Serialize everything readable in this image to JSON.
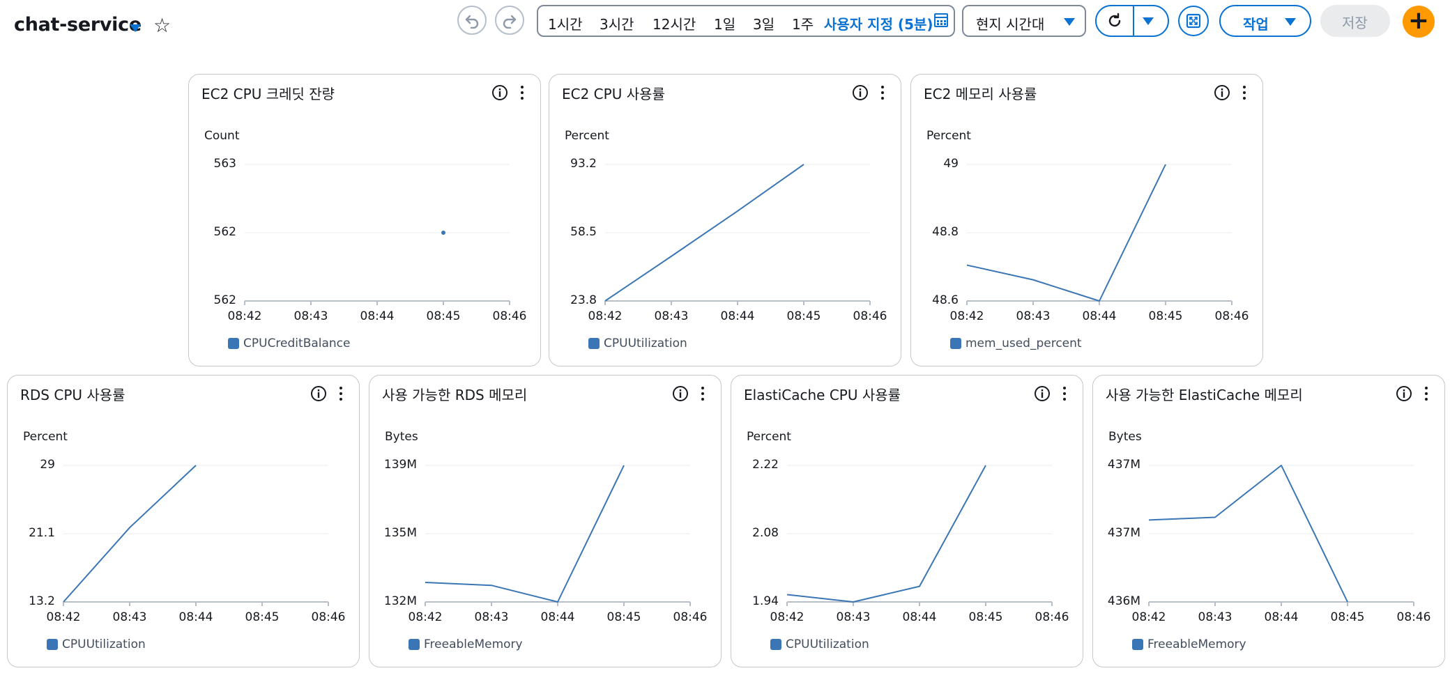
{
  "header": {
    "title": "chat-service",
    "time_ranges": [
      "1시간",
      "3시간",
      "12시간",
      "1일",
      "3일",
      "1주"
    ],
    "custom_range": "사용자 지정 (5분)",
    "timezone": "현지 시간대",
    "action_label": "작업",
    "save_label": "저장",
    "add_label": "+",
    "icons": [
      "undo-icon",
      "redo-icon",
      "calendar-icon",
      "refresh-icon",
      "fullscreen-icon",
      "star-icon"
    ]
  },
  "colors": {
    "accent": "#0972d3",
    "series": "#3a75b5",
    "add_button": "#ff9900",
    "grid": "#e9ebed"
  },
  "x_ticks": [
    "08:42",
    "08:43",
    "08:44",
    "08:45",
    "08:46"
  ],
  "widgets": [
    {
      "title": "EC2 CPU 크레딧 잔량",
      "unit": "Count",
      "legend": "CPUCreditBalance",
      "chart_data": {
        "type": "scatter",
        "x": [
          "08:45"
        ],
        "yticks": [
          "563",
          "562",
          "562"
        ],
        "ylim": [
          561.5,
          562.5
        ],
        "series": [
          {
            "name": "CPUCreditBalance",
            "values": [
              null,
              null,
              null,
              562
            ]
          }
        ]
      }
    },
    {
      "title": "EC2 CPU 사용률",
      "unit": "Percent",
      "legend": "CPUUtilization",
      "chart_data": {
        "type": "line",
        "x": [
          "08:42",
          "08:43",
          "08:44",
          "08:45"
        ],
        "yticks": [
          "93.2",
          "58.5",
          "23.8"
        ],
        "ylim": [
          23.8,
          93.2
        ],
        "series": [
          {
            "name": "CPUUtilization",
            "values": [
              23.8,
              46.5,
              69.5,
              93.2
            ]
          }
        ]
      }
    },
    {
      "title": "EC2 메모리 사용률",
      "unit": "Percent",
      "legend": "mem_used_percent",
      "chart_data": {
        "type": "line",
        "x": [
          "08:42",
          "08:43",
          "08:44",
          "08:45"
        ],
        "yticks": [
          "49",
          "48.8",
          "48.6"
        ],
        "ylim": [
          48.6,
          49.0
        ],
        "series": [
          {
            "name": "mem_used_percent",
            "values": [
              48.705,
              48.662,
              48.6,
              49.0
            ]
          }
        ]
      }
    },
    {
      "title": "RDS CPU 사용률",
      "unit": "Percent",
      "legend": "CPUUtilization",
      "chart_data": {
        "type": "line",
        "x": [
          "08:42",
          "08:43",
          "08:44"
        ],
        "yticks": [
          "29",
          "21.1",
          "13.2"
        ],
        "ylim": [
          13.2,
          29.0
        ],
        "series": [
          {
            "name": "CPUUtilization",
            "values": [
              13.2,
              21.8,
              29.0
            ]
          }
        ]
      }
    },
    {
      "title": "사용 가능한 RDS 메모리",
      "unit": "Bytes",
      "legend": "FreeableMemory",
      "chart_data": {
        "type": "line",
        "x": [
          "08:42",
          "08:43",
          "08:44",
          "08:45"
        ],
        "yticks": [
          "139M",
          "135M",
          "132M"
        ],
        "ylim": [
          132,
          139
        ],
        "series": [
          {
            "name": "FreeableMemory",
            "values": [
              133.0,
              132.85,
              132.0,
              139.0
            ]
          }
        ]
      }
    },
    {
      "title": "ElastiCache CPU 사용률",
      "unit": "Percent",
      "legend": "CPUUtilization",
      "chart_data": {
        "type": "line",
        "x": [
          "08:42",
          "08:43",
          "08:44",
          "08:45"
        ],
        "yticks": [
          "2.22",
          "2.08",
          "1.94"
        ],
        "ylim": [
          1.94,
          2.22
        ],
        "series": [
          {
            "name": "CPUUtilization",
            "values": [
              1.955,
              1.94,
              1.972,
              2.22
            ]
          }
        ]
      }
    },
    {
      "title": "사용 가능한 ElastiCache 메모리",
      "unit": "Bytes",
      "legend": "FreeableMemory",
      "chart_data": {
        "type": "line",
        "x": [
          "08:42",
          "08:43",
          "08:44",
          "08:45"
        ],
        "yticks": [
          "437M",
          "437M",
          "436M"
        ],
        "ylim": [
          436.0,
          437.0
        ],
        "series": [
          {
            "name": "FreeableMemory",
            "values": [
              436.6,
              436.62,
              437.0,
              436.0
            ]
          }
        ]
      }
    }
  ]
}
